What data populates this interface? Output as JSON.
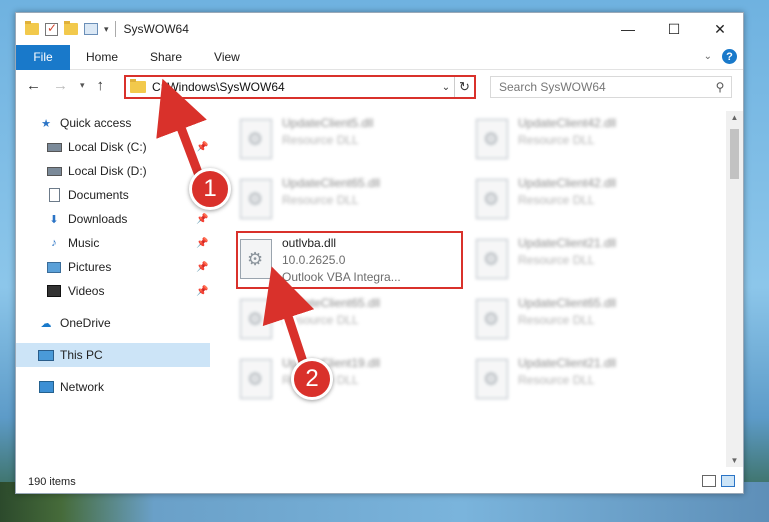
{
  "window": {
    "title": "SysWOW64",
    "minimize": "—",
    "maximize": "☐",
    "close": "✕"
  },
  "ribbon": {
    "file": "File",
    "tabs": [
      "Home",
      "Share",
      "View"
    ],
    "help": "?",
    "expand": "⌄"
  },
  "address": {
    "path": "C:\\Windows\\SysWOW64",
    "search_placeholder": "Search SysWOW64"
  },
  "nav": {
    "items": [
      {
        "label": "Quick access",
        "icon": "star-icon",
        "pinned": false
      },
      {
        "label": "Local Disk (C:)",
        "icon": "disk-icon",
        "pinned": true
      },
      {
        "label": "Local Disk (D:)",
        "icon": "disk-icon",
        "pinned": false
      },
      {
        "label": "Documents",
        "icon": "documents-icon",
        "pinned": false
      },
      {
        "label": "Downloads",
        "icon": "download-icon",
        "pinned": true
      },
      {
        "label": "Music",
        "icon": "music-icon",
        "pinned": true
      },
      {
        "label": "Pictures",
        "icon": "pictures-icon",
        "pinned": true
      },
      {
        "label": "Videos",
        "icon": "videos-icon",
        "pinned": true
      },
      {
        "label": "OneDrive",
        "icon": "cloud-icon",
        "pinned": false
      },
      {
        "label": "This PC",
        "icon": "pc-icon",
        "pinned": false,
        "selected": true
      },
      {
        "label": "Network",
        "icon": "network-icon",
        "pinned": false
      }
    ]
  },
  "files": [
    {
      "name": "UpdateClient5.dll",
      "sub": "Resource DLL",
      "sub2": ""
    },
    {
      "name": "UpdateClient42.dll",
      "sub": "Resource DLL",
      "sub2": ""
    },
    {
      "name": "UpdateClient65.dll",
      "sub": "Resource DLL",
      "sub2": ""
    },
    {
      "name": "UpdateClient42.dll",
      "sub": "Resource DLL",
      "sub2": ""
    },
    {
      "name": "outlvba.dll",
      "sub": "10.0.2625.0",
      "sub2": "Outlook VBA Integra..."
    },
    {
      "name": "UpdateClient21.dll",
      "sub": "Resource DLL",
      "sub2": ""
    },
    {
      "name": "UpdateClient65.dll",
      "sub": "Resource DLL",
      "sub2": ""
    },
    {
      "name": "UpdateClient65.dll",
      "sub": "Resource DLL",
      "sub2": ""
    },
    {
      "name": "UpdateClient19.dll",
      "sub": "Resource DLL",
      "sub2": ""
    },
    {
      "name": "UpdateClient21.dll",
      "sub": "Resource DLL",
      "sub2": ""
    }
  ],
  "status": {
    "item_count": "190 items"
  },
  "callouts": {
    "step1": "1",
    "step2": "2"
  },
  "colors": {
    "accent": "#1979ca",
    "highlight_red": "#d9312b",
    "selected_bg": "#cce4f7"
  }
}
